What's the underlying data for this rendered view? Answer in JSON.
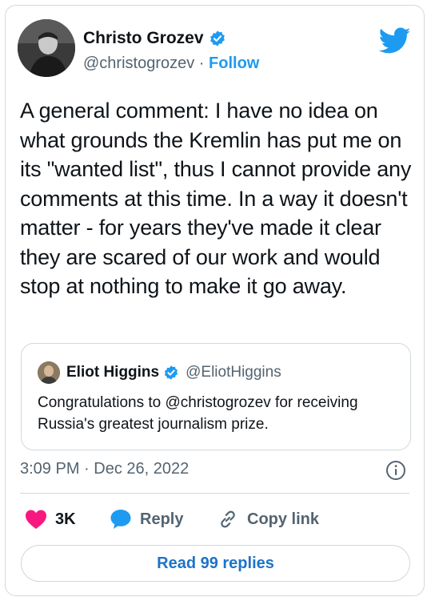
{
  "author": {
    "name": "Christo Grozev",
    "handle": "@christogrozev",
    "separator": " · ",
    "follow_label": "Follow"
  },
  "tweet": {
    "text": "A general comment: I have no idea on what grounds the Kremlin has put me on its \"wanted list\", thus I cannot provide any comments at this time. In a way it doesn't matter - for years they've made it clear they are scared of our work and would stop at nothing to make it go away.",
    "timestamp": "3:09 PM · Dec 26, 2022"
  },
  "quoted_tweet": {
    "name": "Eliot Higgins",
    "handle": "@EliotHiggins",
    "text": "Congratulations to @christogrozev for receiving Russia's greatest journalism prize."
  },
  "actions": {
    "like_count": "3K",
    "reply_label": "Reply",
    "copy_link_label": "Copy link"
  },
  "read_replies_label": "Read 99 replies",
  "icons": {
    "brand": "twitter-bird-icon",
    "verified": "verified-badge-icon",
    "like": "heart-icon",
    "reply": "speech-bubble-icon",
    "copy": "link-icon",
    "info": "info-icon"
  },
  "colors": {
    "brand_blue": "#1d9bf0",
    "like_red": "#f91880",
    "text_primary": "#0f1419",
    "text_secondary": "#536471",
    "border": "#cfd9de"
  }
}
